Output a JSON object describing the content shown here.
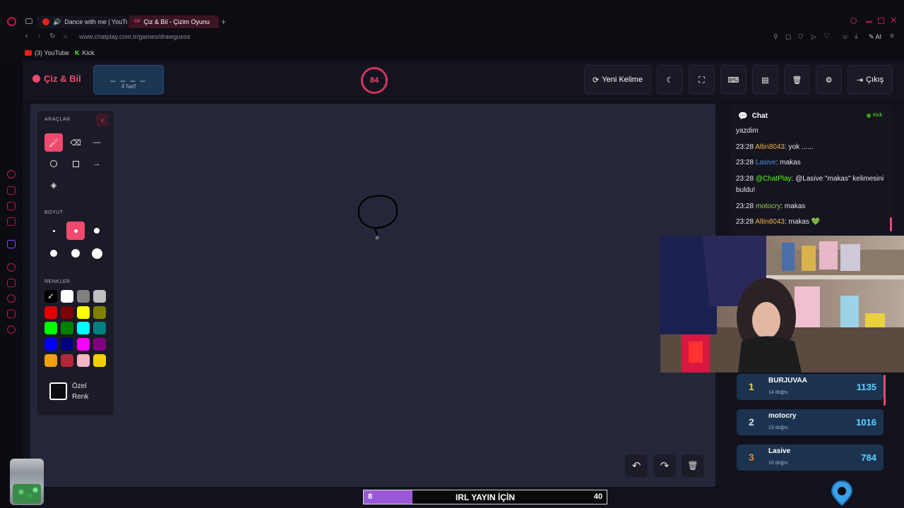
{
  "browser": {
    "tabs": [
      {
        "label": "Dance with me | YouTu",
        "active": false
      },
      {
        "label": "Çiz & Bil - Çizim Oyunu",
        "active": true,
        "favicon": "CP"
      }
    ],
    "url": "www.chatplay.com.tr/games/drawguess",
    "bookmarks": [
      {
        "label": "(3) YouTube",
        "icon": "youtube-icon"
      },
      {
        "label": "Kick",
        "icon": "kick-icon"
      }
    ],
    "ai_label": "AI"
  },
  "header": {
    "logo": "Çiz & Bil",
    "word_blanks": "_ _ _ _",
    "word_hint": "4 harf",
    "timer": "84",
    "new_word_label": "Yeni Kelime",
    "exit_label": "Çıkış"
  },
  "tools": {
    "tools_label": "ARAÇLAR",
    "size_label": "BOYUT",
    "colors_label": "RENKLER",
    "custom_color_label_1": "Özel",
    "custom_color_label_2": "Renk",
    "colors": [
      "#000000",
      "#ffffff",
      "#808080",
      "#c0c0c0",
      "#e00000",
      "#800000",
      "#ffff00",
      "#808000",
      "#00ff00",
      "#008000",
      "#00ffff",
      "#008080",
      "#0000ff",
      "#000080",
      "#ff00ff",
      "#800080",
      "#f0a010",
      "#b0283a",
      "#f4b6c2",
      "#f0d000"
    ],
    "selected_color": "#000000",
    "selected_tool": "brush",
    "selected_size_index": 1
  },
  "chat": {
    "title": "Chat",
    "platform": "Kick",
    "messages": [
      {
        "time": "",
        "user": "",
        "user_color": "#e8e8e8",
        "text": "yazdim"
      },
      {
        "time": "23:28",
        "user": "Altin8043",
        "user_color": "#f0b34a",
        "text": ": yok ......"
      },
      {
        "time": "23:28",
        "user": "Lasive",
        "user_color": "#4a8fe0",
        "text": ": makas"
      },
      {
        "time": "23:28",
        "user": "@ChatPlay",
        "user_color": "#53fc18",
        "text": ": @Lasive \"makas\" kelimesini buldu!"
      },
      {
        "time": "23:28",
        "user": "motocry",
        "user_color": "#8fd14f",
        "text": ": makas"
      },
      {
        "time": "23:28",
        "user": "Altin8043",
        "user_color": "#f0b34a",
        "text": ": makas 💚"
      }
    ]
  },
  "leaderboard": [
    {
      "rank": "1",
      "name": "BURJUVAA",
      "sub": "14 doğru",
      "score": "1135",
      "rank_color": "#f5d33a"
    },
    {
      "rank": "2",
      "name": "motocry",
      "sub": "13 doğru",
      "score": "1016",
      "rank_color": "#d8dde3"
    },
    {
      "rank": "3",
      "name": "Lasive",
      "sub": "10 doğru",
      "score": "784",
      "rank_color": "#e08a3a"
    }
  ],
  "goal": {
    "current": "8",
    "label": "IRL YAYIN İÇİN",
    "target": "40",
    "progress": 0.2
  }
}
